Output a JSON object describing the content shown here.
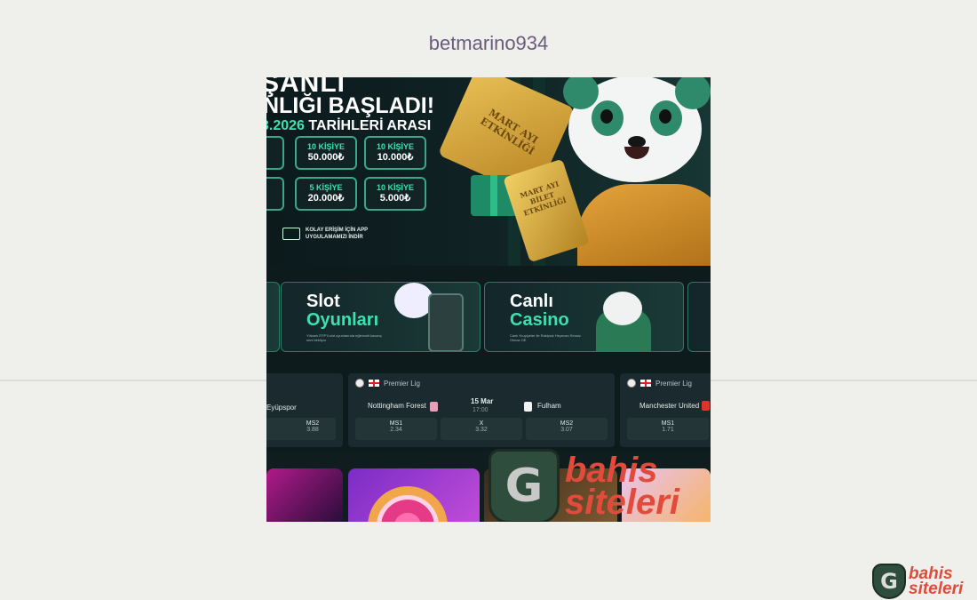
{
  "page": {
    "title": "betmarino934"
  },
  "hero": {
    "line1": "ŞANLI",
    "line2": "NLIĞI BAŞLADI!",
    "line3_highlight": "3.2026",
    "line3_rest": " TARİHLERİ ARASI",
    "prizes": [
      {
        "top": "10 KİŞİYE",
        "amount": "50.000₺"
      },
      {
        "top": "10 KİŞİYE",
        "amount": "10.000₺"
      },
      {
        "top": "5 KİŞİYE",
        "amount": "20.000₺"
      },
      {
        "top": "10 KİŞİYE",
        "amount": "5.000₺"
      }
    ],
    "partial_prize_1": "₺",
    "partial_prize_2": "₺",
    "app_note": "KOLAY ERİŞİM İÇİN APP UYGULAMAMIZI İNDİR",
    "ticket_text": "MART AYI ETKİNLİĞİ",
    "ticket2_text": "MART AYI BİLET ETKİNLİĞİ"
  },
  "categories": [
    {
      "line1": "Slot",
      "line2": "Oyunları",
      "small": "Yüksek RTP'li slot oyunlarında eğlenceli kazanç seni bekliyor"
    },
    {
      "line1": "Canlı",
      "line2": "Casino",
      "small": "Canlı Krupiyeler ile Rakipsiz Heyecan Sensiz Olmaz OE"
    }
  ],
  "matches": [
    {
      "home_partial": "Eyüpspor",
      "ms2_label": "MS2",
      "ms2_value": "3.88"
    },
    {
      "league": "Premier Lig",
      "home": "Nottingham Forest",
      "away": "Fulham",
      "date": "15 Mar",
      "time": "17:00",
      "odds": [
        {
          "k": "MS1",
          "v": "2.34"
        },
        {
          "k": "X",
          "v": "3.32"
        },
        {
          "k": "MS2",
          "v": "3.07"
        }
      ]
    },
    {
      "league": "Premier Lig",
      "home": "Manchester United",
      "odds": [
        {
          "k": "MS1",
          "v": "1.71"
        }
      ]
    }
  ],
  "watermark": {
    "letter": "G",
    "word1": "bahis",
    "word2": "siteleri"
  },
  "colors": {
    "accent": "#3fe0b0",
    "background": "#efefec",
    "title": "#6b5b7b",
    "brand_red": "#e24b3b"
  },
  "icons": [
    "soccer-ball-icon",
    "england-flag-icon",
    "devices-icon"
  ]
}
